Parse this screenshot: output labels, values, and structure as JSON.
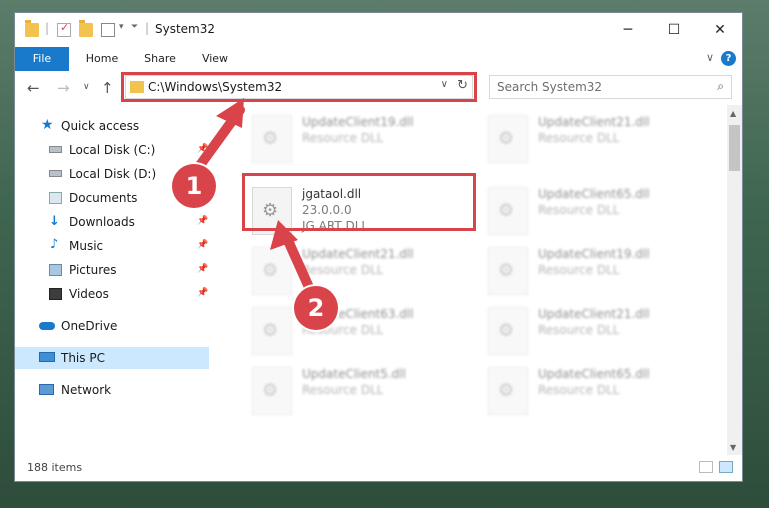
{
  "titlebar": {
    "title": "System32",
    "minimize": "─",
    "maximize": "☐",
    "close": "✕"
  },
  "ribbon": {
    "tabs": [
      "File",
      "Home",
      "Share",
      "View"
    ],
    "help": "?",
    "expand": "∨"
  },
  "nav": {
    "back": "←",
    "forward": "→",
    "recent": "∨",
    "up": "↑",
    "address": "C:\\Windows\\System32",
    "search_placeholder": "Search System32",
    "refresh": "↻",
    "dropdown": "∨",
    "search_icon": "⌕"
  },
  "sidebar": {
    "items": [
      {
        "label": "Quick access",
        "icon": "star-icon"
      },
      {
        "label": "Local Disk (C:)",
        "icon": "drive-icon"
      },
      {
        "label": "Local Disk (D:)",
        "icon": "drive-icon"
      },
      {
        "label": "Documents",
        "icon": "documents-icon"
      },
      {
        "label": "Downloads",
        "icon": "download-icon"
      },
      {
        "label": "Music",
        "icon": "music-icon"
      },
      {
        "label": "Pictures",
        "icon": "pictures-icon"
      },
      {
        "label": "Videos",
        "icon": "videos-icon"
      },
      {
        "label": "OneDrive",
        "icon": "cloud-icon"
      },
      {
        "label": "This PC",
        "icon": "computer-icon"
      },
      {
        "label": "Network",
        "icon": "network-icon"
      }
    ],
    "pin": "📌"
  },
  "files": {
    "highlighted": {
      "name": "jgataol.dll",
      "version": "23.0.0.0",
      "description": "JG ART DLL"
    },
    "others": [
      {
        "name": "UpdateClient19.dll",
        "description": "Resource DLL"
      },
      {
        "name": "UpdateClient21.dll",
        "description": "Resource DLL"
      },
      {
        "name": "UpdateClient65.dll",
        "description": "Resource DLL"
      },
      {
        "name": "UpdateClient21.dll",
        "description": "Resource DLL"
      },
      {
        "name": "UpdateClient19.dll",
        "description": "Resource DLL"
      },
      {
        "name": "UpdateClient63.dll",
        "description": "Resource DLL"
      },
      {
        "name": "UpdateClient21.dll",
        "description": "Resource DLL"
      },
      {
        "name": "UpdateClient5.dll",
        "description": "Resource DLL"
      },
      {
        "name": "UpdateClient65.dll",
        "description": "Resource DLL"
      }
    ]
  },
  "status": {
    "item_count": "188 items"
  },
  "badges": {
    "one": "1",
    "two": "2"
  },
  "colors": {
    "accent": "#1979ca",
    "highlight": "#d9434a",
    "selected": "#cce8ff"
  }
}
